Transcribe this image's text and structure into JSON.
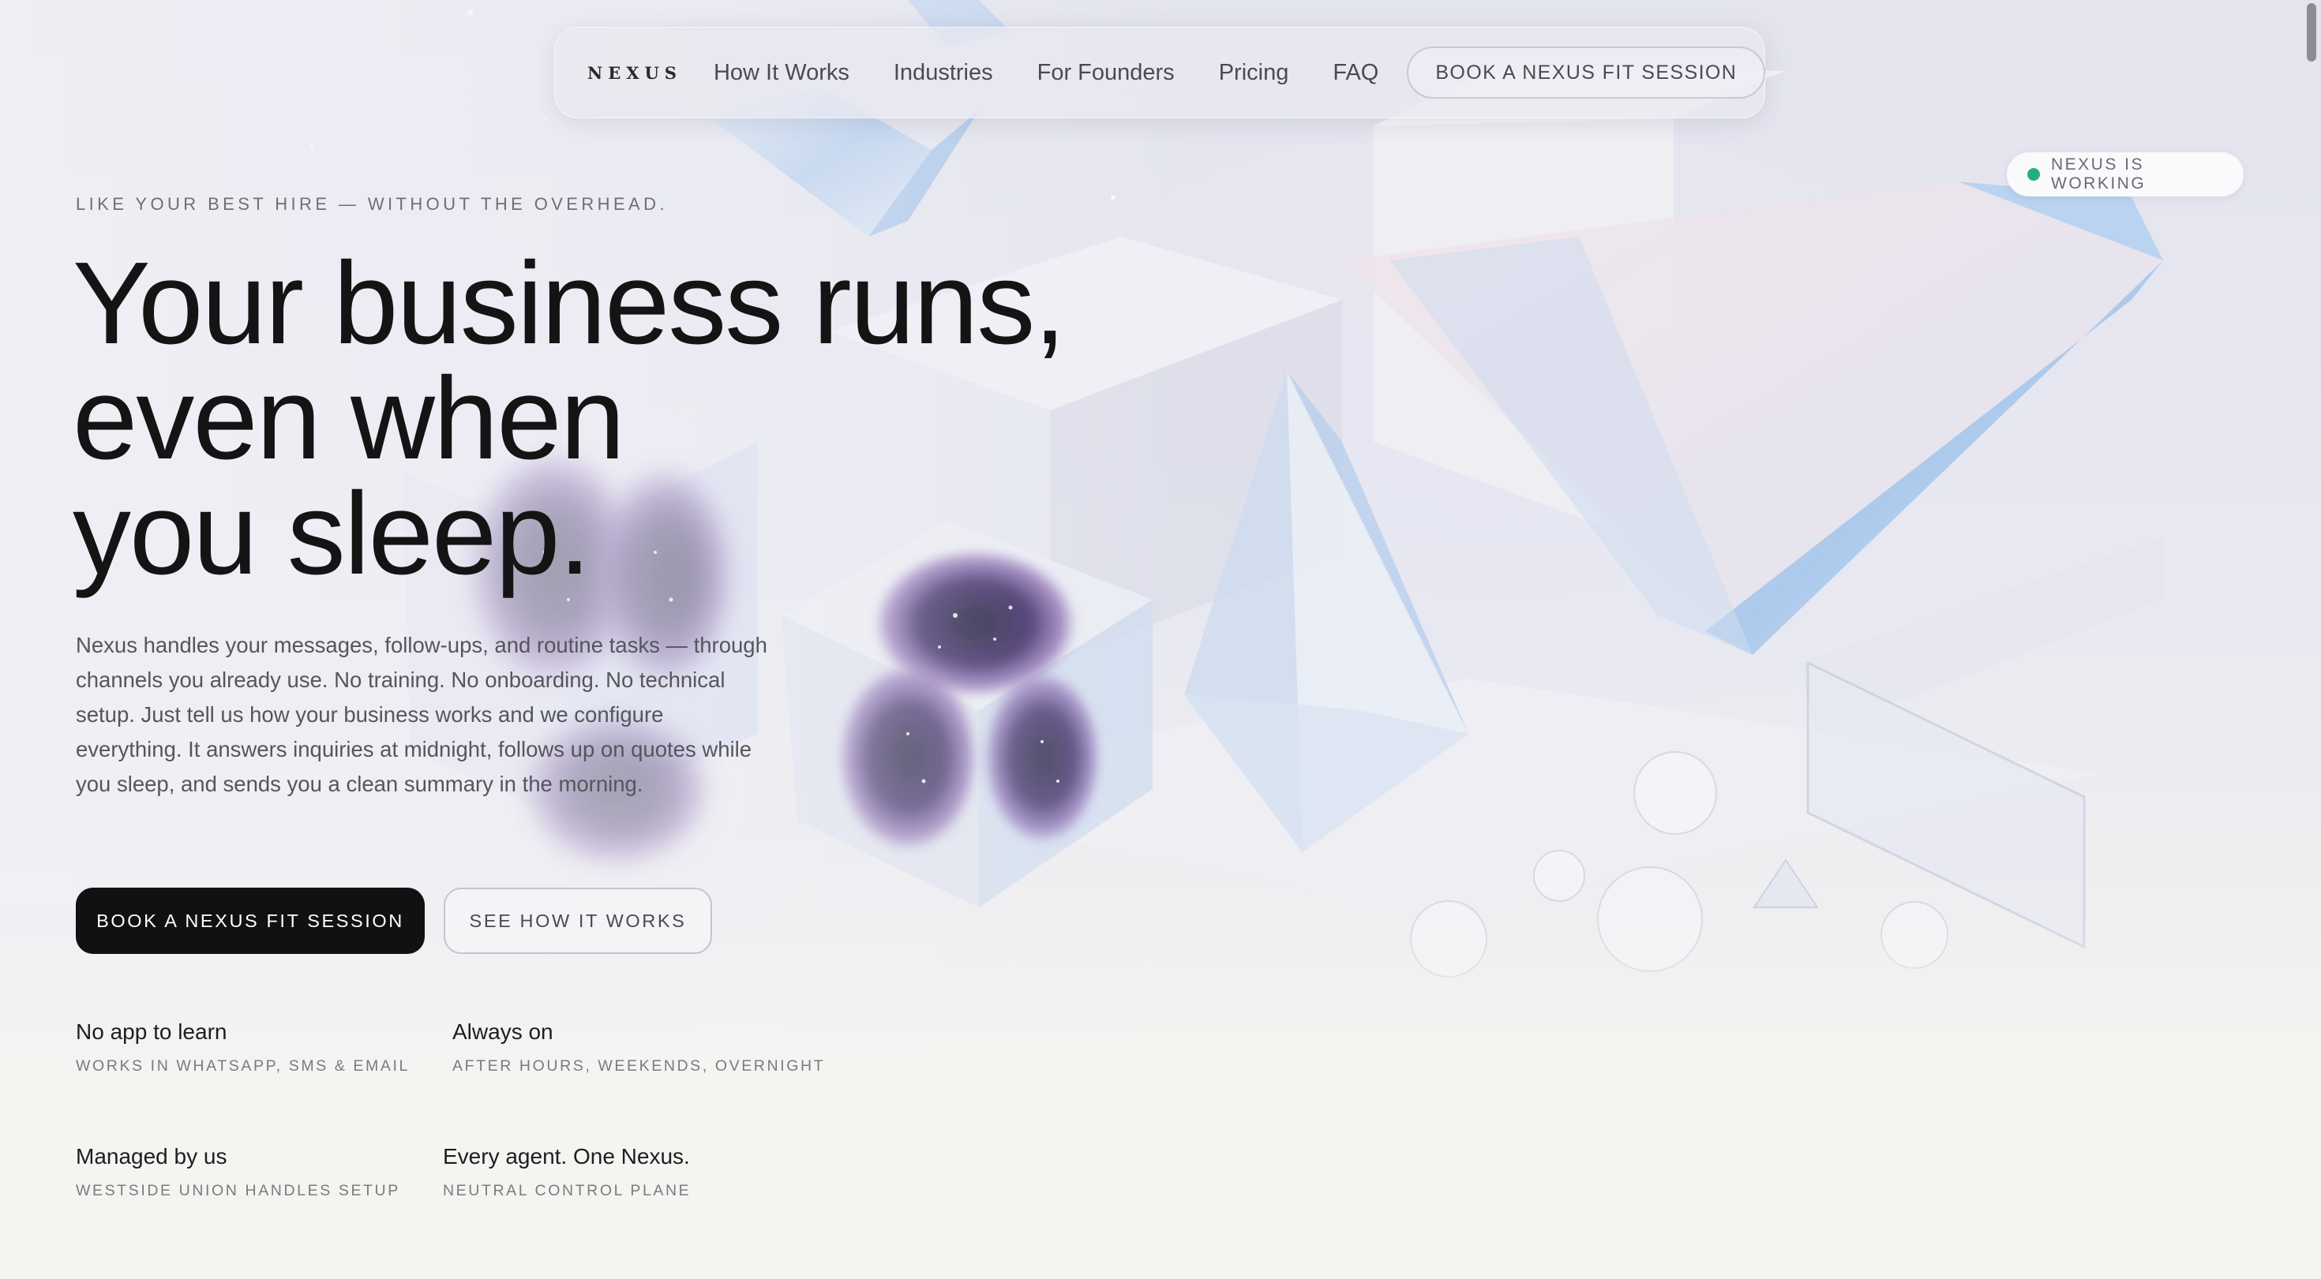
{
  "nav": {
    "brand": "NEXUS",
    "links": [
      "How It Works",
      "Industries",
      "For Founders",
      "Pricing",
      "FAQ"
    ],
    "cta": "BOOK A NEXUS FIT SESSION"
  },
  "status": {
    "label": "NEXUS IS WORKING",
    "dot_color": "#22b07a"
  },
  "hero": {
    "eyebrow": "LIKE YOUR BEST HIRE — WITHOUT THE OVERHEAD.",
    "headline": [
      "Your business runs,",
      "even when",
      "you sleep."
    ],
    "body": "Nexus handles your messages, follow-ups, and routine tasks — through channels you already use. No training. No onboarding. No technical setup. Just tell us how your business works and we configure everything. It answers inquiries at midnight, follows up on quotes while you sleep, and sends you a clean summary in the morning.",
    "primary_cta": "BOOK A NEXUS FIT SESSION",
    "secondary_cta": "SEE HOW IT WORKS"
  },
  "features": [
    {
      "title": "No app to learn",
      "subtitle": "WORKS IN WHATSAPP, SMS & EMAIL"
    },
    {
      "title": "Always on",
      "subtitle": "AFTER HOURS, WEEKENDS, OVERNIGHT"
    },
    {
      "title": "Managed by us",
      "subtitle": "WESTSIDE UNION HANDLES SETUP"
    },
    {
      "title": "Every agent. One Nexus.",
      "subtitle": "NEUTRAL CONTROL PLANE"
    }
  ],
  "colors": {
    "primary_button": "#111111",
    "text": "#141414",
    "muted": "#55555c",
    "background": "#f5f4f1"
  }
}
